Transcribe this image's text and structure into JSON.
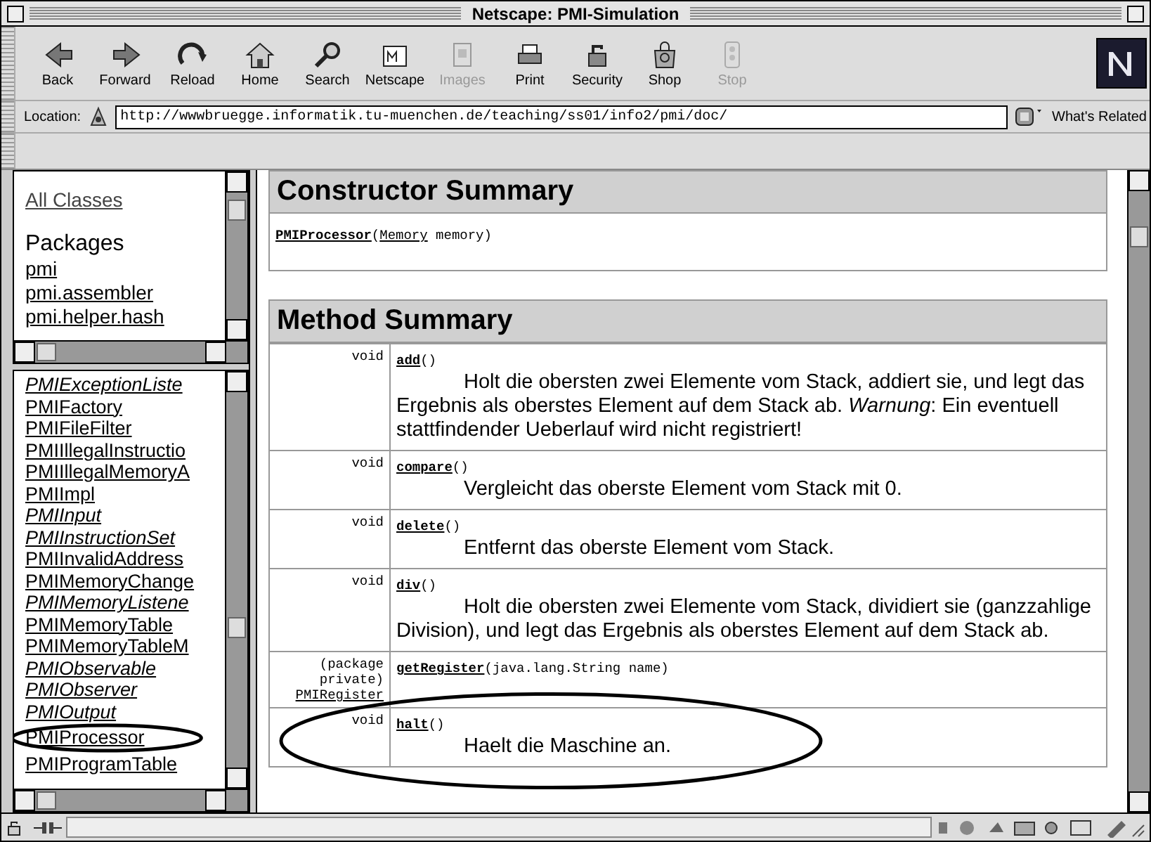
{
  "window": {
    "title": "Netscape: PMI-Simulation"
  },
  "toolbar": {
    "buttons": [
      {
        "label": "Back",
        "kind": "back",
        "disabled": false
      },
      {
        "label": "Forward",
        "kind": "forward",
        "disabled": false
      },
      {
        "label": "Reload",
        "kind": "reload",
        "disabled": false
      },
      {
        "label": "Home",
        "kind": "home",
        "disabled": false
      },
      {
        "label": "Search",
        "kind": "search",
        "disabled": false
      },
      {
        "label": "Netscape",
        "kind": "netscape",
        "disabled": false
      },
      {
        "label": "Images",
        "kind": "images",
        "disabled": true
      },
      {
        "label": "Print",
        "kind": "print",
        "disabled": false
      },
      {
        "label": "Security",
        "kind": "security",
        "disabled": false
      },
      {
        "label": "Shop",
        "kind": "shop",
        "disabled": false
      },
      {
        "label": "Stop",
        "kind": "stop",
        "disabled": true
      }
    ]
  },
  "location": {
    "label": "Location:",
    "url": "http://wwwbruegge.informatik.tu-muenchen.de/teaching/ss01/info2/pmi/doc/",
    "related": "What's Related"
  },
  "packages_frame": {
    "all_classes": "All Classes",
    "heading": "Packages",
    "packages": [
      "pmi",
      "pmi.assembler",
      "pmi.helper.hash"
    ]
  },
  "classes_frame": {
    "classes": [
      {
        "name": "PMIExceptionListe",
        "kind": "interface",
        "circled": false
      },
      {
        "name": "PMIFactory",
        "kind": "class",
        "circled": false
      },
      {
        "name": "PMIFileFilter",
        "kind": "class",
        "circled": false
      },
      {
        "name": "PMIIllegalInstructio",
        "kind": "class",
        "circled": false
      },
      {
        "name": "PMIIllegalMemoryA",
        "kind": "class",
        "circled": false
      },
      {
        "name": "PMIImpl",
        "kind": "class",
        "circled": false
      },
      {
        "name": "PMIInput",
        "kind": "interface",
        "circled": false
      },
      {
        "name": "PMIInstructionSet",
        "kind": "interface",
        "circled": false
      },
      {
        "name": "PMIInvalidAddress",
        "kind": "class",
        "circled": false
      },
      {
        "name": "PMIMemoryChange",
        "kind": "class",
        "circled": false
      },
      {
        "name": "PMIMemoryListene",
        "kind": "interface",
        "circled": false
      },
      {
        "name": "PMIMemoryTable",
        "kind": "class",
        "circled": false
      },
      {
        "name": "PMIMemoryTableM",
        "kind": "class",
        "circled": false
      },
      {
        "name": "PMIObservable",
        "kind": "interface",
        "circled": false
      },
      {
        "name": "PMIObserver",
        "kind": "interface",
        "circled": false
      },
      {
        "name": "PMIOutput",
        "kind": "interface",
        "circled": false
      },
      {
        "name": "PMIProcessor",
        "kind": "class",
        "circled": true
      },
      {
        "name": "PMIProgramTable",
        "kind": "class",
        "circled": false
      }
    ]
  },
  "constructor_summary": {
    "heading": "Constructor Summary",
    "constructors": [
      {
        "signature": [
          {
            "text": "PMIProcessor",
            "kind": "name"
          },
          {
            "text": "(",
            "kind": "plain"
          },
          {
            "text": "Memory",
            "kind": "link"
          },
          {
            "text": " memory)",
            "kind": "plain"
          }
        ]
      }
    ]
  },
  "method_summary": {
    "heading": "Method Summary",
    "methods": [
      {
        "type": "void",
        "type_link": false,
        "signature": [
          {
            "text": "add",
            "kind": "name"
          },
          {
            "text": "()",
            "kind": "plain"
          }
        ],
        "description": "Holt die obersten zwei Elemente vom Stack, addiert sie, und legt das Ergebnis als oberstes Element auf dem Stack ab. *Warnung*: Ein eventuell stattfindender Ueberlauf wird nicht registriert!",
        "circled": false
      },
      {
        "type": "void",
        "type_link": false,
        "signature": [
          {
            "text": "compare",
            "kind": "name"
          },
          {
            "text": "()",
            "kind": "plain"
          }
        ],
        "description": "Vergleicht das oberste Element vom Stack mit 0.",
        "circled": false
      },
      {
        "type": "void",
        "type_link": false,
        "signature": [
          {
            "text": "delete",
            "kind": "name"
          },
          {
            "text": "()",
            "kind": "plain"
          }
        ],
        "description": "Entfernt das oberste Element vom Stack.",
        "circled": false
      },
      {
        "type": "void",
        "type_link": false,
        "signature": [
          {
            "text": "div",
            "kind": "name"
          },
          {
            "text": "()",
            "kind": "plain"
          }
        ],
        "description": "Holt die obersten zwei Elemente vom Stack, dividiert sie (ganzzahlige Division), und legt das Ergebnis als oberstes Element auf dem Stack ab.",
        "circled": false
      },
      {
        "modifier": "(package private)",
        "type": "PMIRegister",
        "type_link": true,
        "signature": [
          {
            "text": "getRegister",
            "kind": "name"
          },
          {
            "text": "(java.lang.String name)",
            "kind": "plain"
          }
        ],
        "circled": false
      },
      {
        "type": "void",
        "type_link": false,
        "signature": [
          {
            "text": "halt",
            "kind": "name"
          },
          {
            "text": "()",
            "kind": "plain"
          }
        ],
        "description": "Haelt die Maschine an.",
        "circled": true
      }
    ]
  }
}
